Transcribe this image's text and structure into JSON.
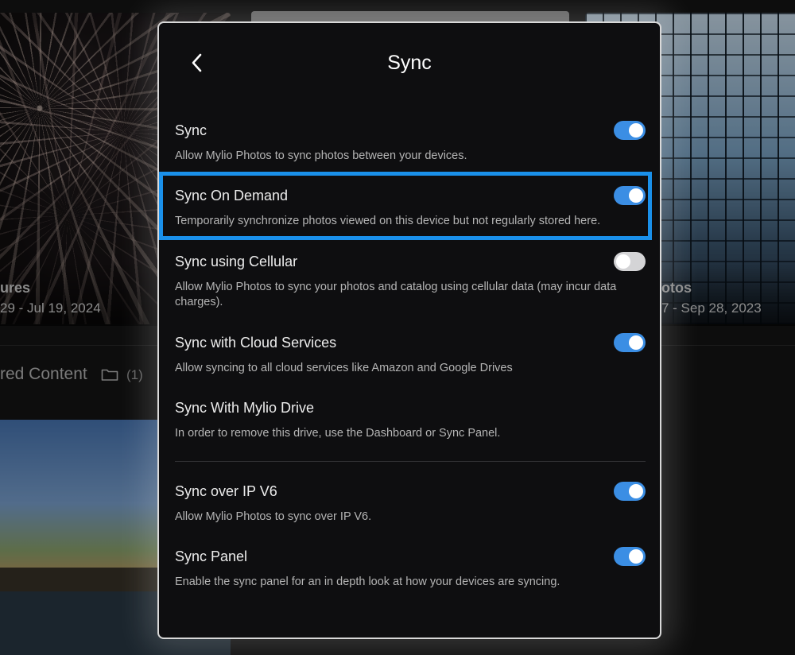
{
  "background": {
    "left_album": {
      "title_fragment": "ures",
      "date_range": "29 - Jul 19, 2024"
    },
    "right_album": {
      "title_fragment": "otos",
      "date_range": "7 - Sep 28, 2023"
    },
    "section": {
      "title_fragment": "red Content",
      "count": "(1)"
    }
  },
  "dialog": {
    "title": "Sync",
    "settings": [
      {
        "label": "Sync",
        "description": "Allow Mylio Photos to sync photos between your devices.",
        "toggle": "on"
      },
      {
        "label": "Sync On Demand",
        "description": "Temporarily synchronize photos viewed on this device but not regularly stored here.",
        "toggle": "on"
      },
      {
        "label": "Sync using Cellular",
        "description": "Allow Mylio Photos to sync your photos and catalog using cellular data (may incur data charges).",
        "toggle": "off"
      },
      {
        "label": "Sync with Cloud Services",
        "description": "Allow syncing to all cloud services like Amazon and Google Drives",
        "toggle": "on"
      },
      {
        "label": "Sync With Mylio Drive",
        "description": "In order to remove this drive, use the Dashboard or Sync Panel.",
        "toggle": null
      },
      {
        "label": "Sync over IP V6",
        "description": "Allow Mylio Photos to sync over IP V6.",
        "toggle": "on"
      },
      {
        "label": "Sync Panel",
        "description": "Enable the sync panel for an in depth look at how your devices are syncing.",
        "toggle": "on"
      }
    ]
  },
  "colors": {
    "accent": "#3b8ee4",
    "highlight": "#1a90ea",
    "dialog_bg": "#0e0e10",
    "toggle_off": "#d4d4d6"
  },
  "icons": {
    "back": "chevron-left-icon",
    "folder": "folder-icon"
  }
}
